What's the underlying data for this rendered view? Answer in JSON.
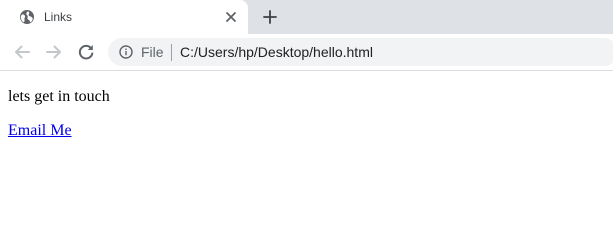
{
  "browser": {
    "tab": {
      "title": "Links",
      "favicon_icon": "globe-icon",
      "close_icon": "close-icon"
    },
    "new_tab_icon": "plus-icon",
    "toolbar": {
      "back_icon": "back-arrow-icon",
      "forward_icon": "forward-arrow-icon",
      "reload_icon": "reload-icon"
    },
    "address_bar": {
      "info_icon": "info-icon",
      "scheme_label": "File",
      "url": "C:/Users/hp/Desktop/hello.html"
    }
  },
  "page": {
    "text": "lets get in touch",
    "link_text": "Email Me"
  },
  "colors": {
    "tab_strip_bg": "#dee1e6",
    "omnibox_bg": "#f1f3f4",
    "link": "#0000ee"
  }
}
